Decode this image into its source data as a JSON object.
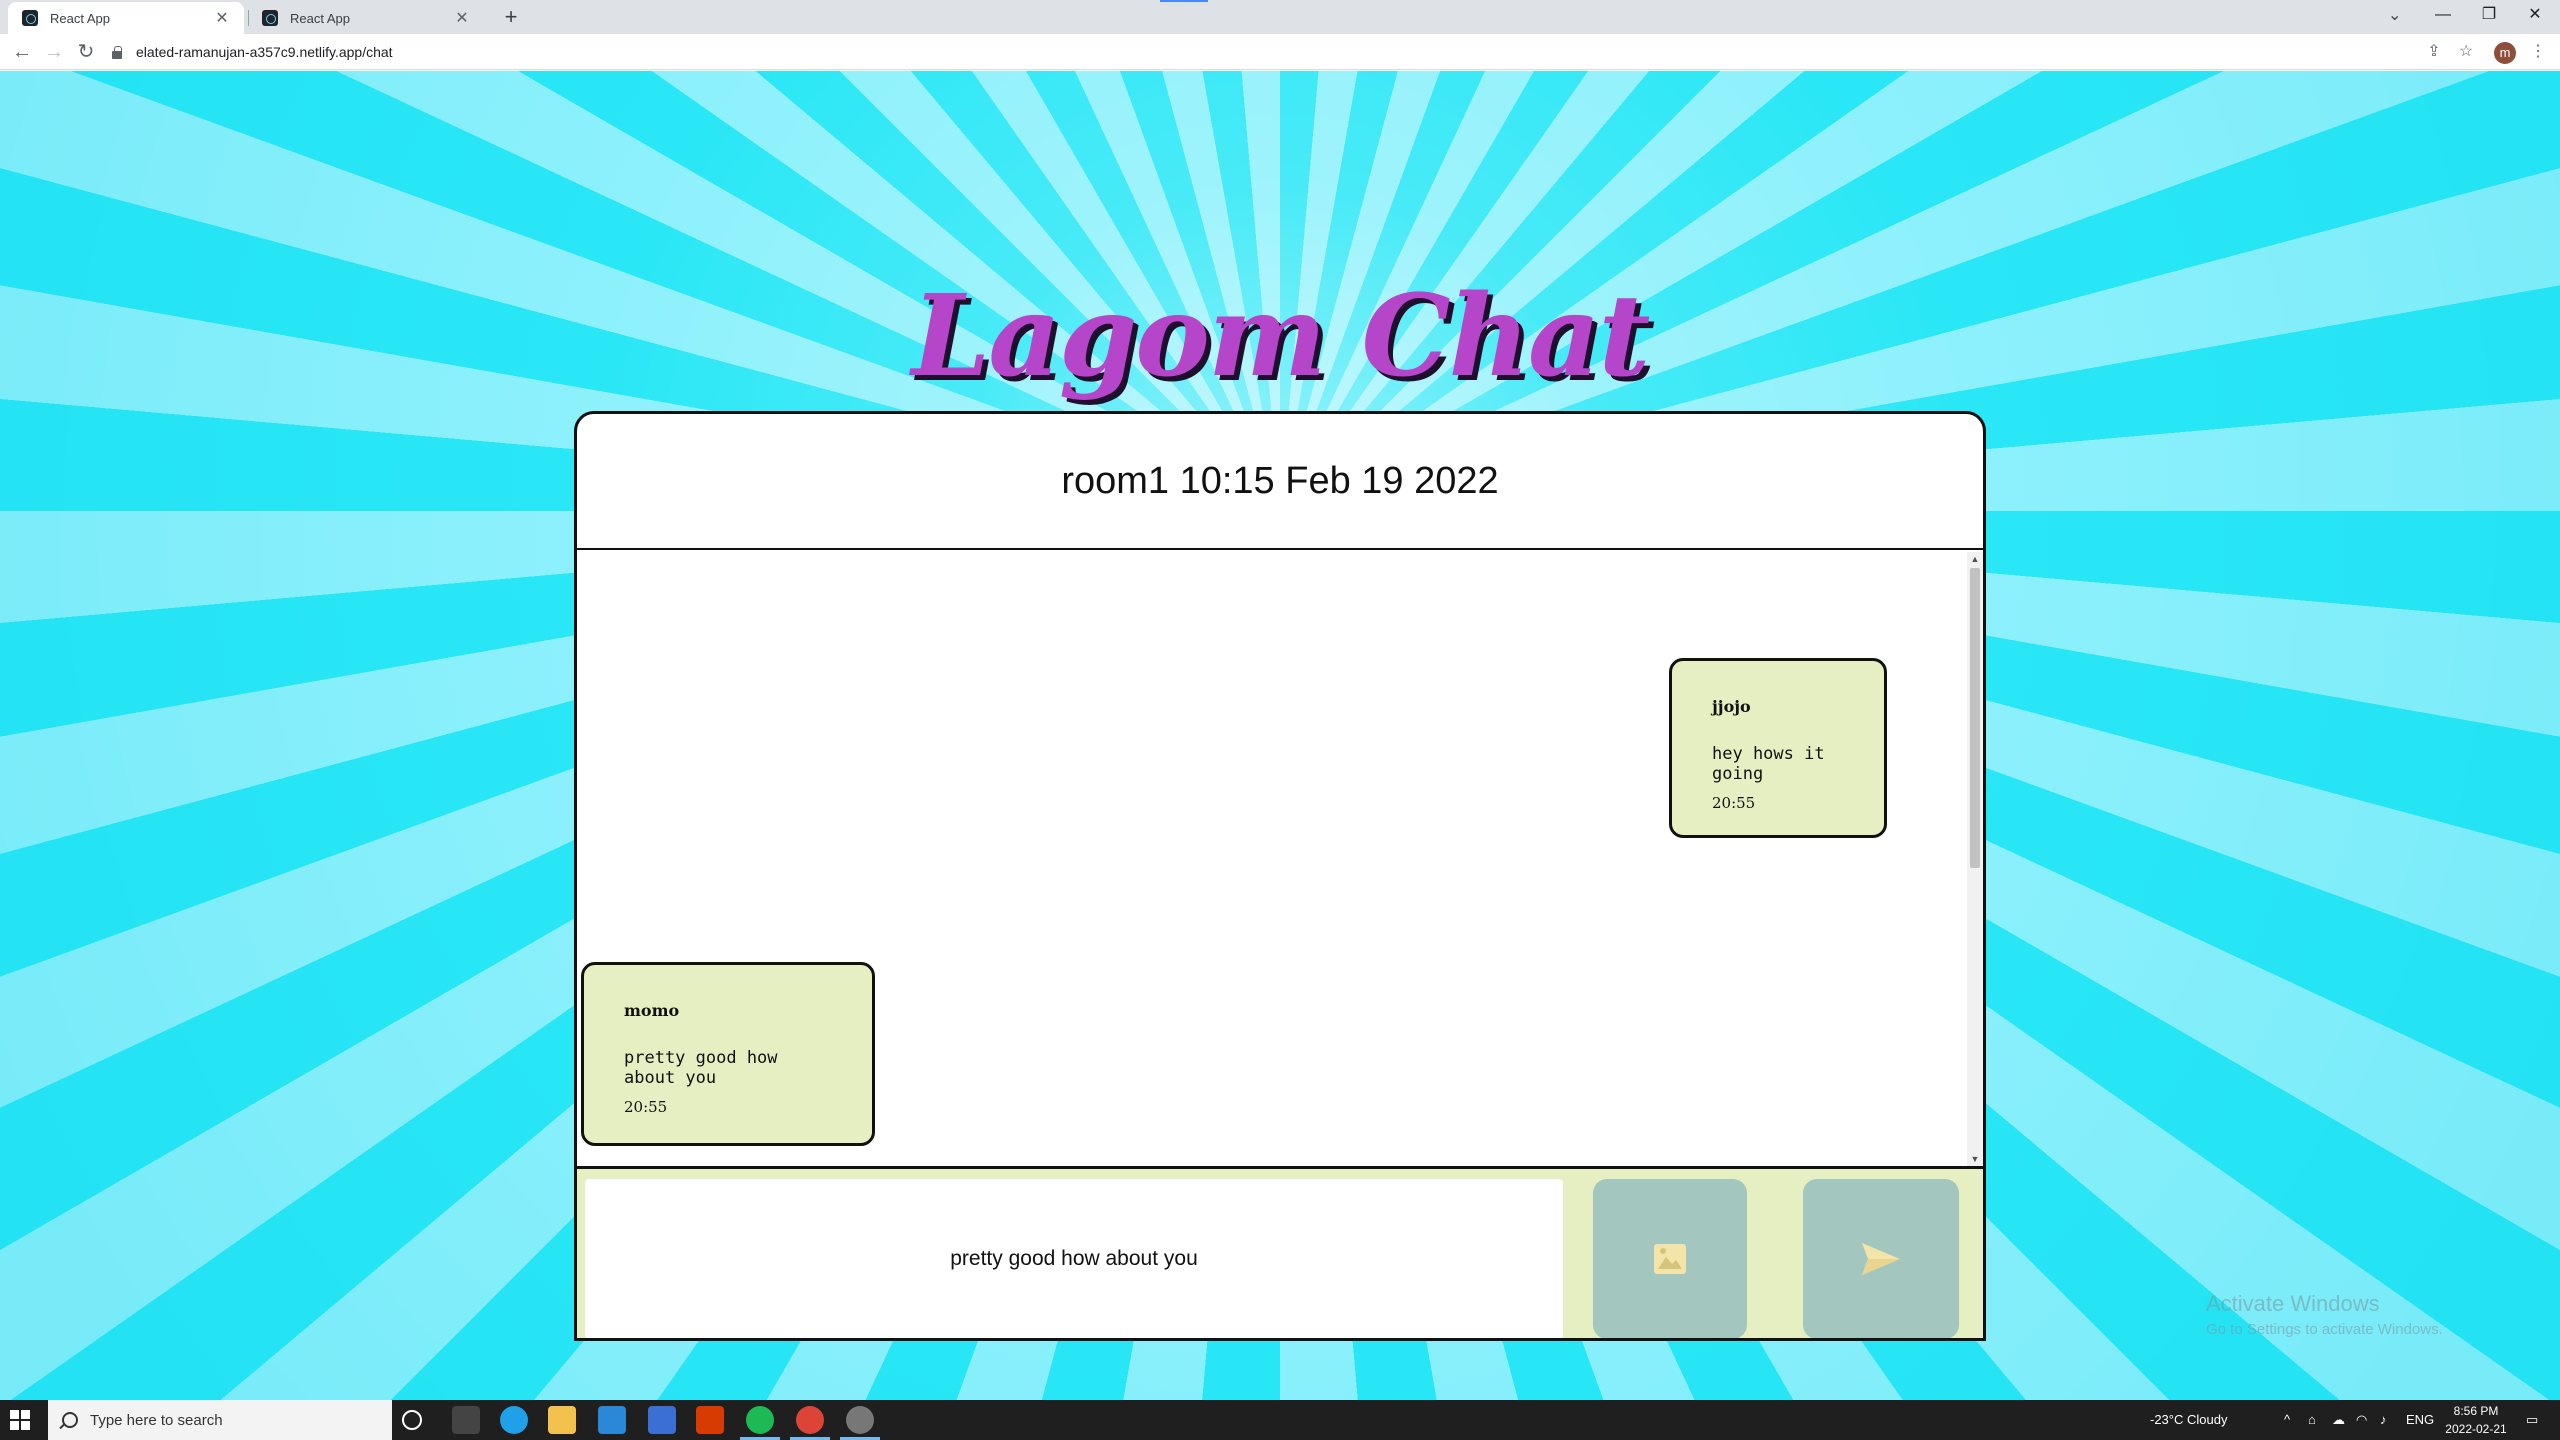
{
  "browser": {
    "tabs": [
      {
        "title": "React App",
        "active": true
      },
      {
        "title": "React App",
        "active": false
      }
    ],
    "url": "elated-ramanujan-a357c9.netlify.app/chat",
    "profile_initial": "m"
  },
  "app": {
    "logo": "Lagom Chat",
    "room_title": "room1 10:15 Feb 19 2022",
    "messages": [
      {
        "author": "jjojo",
        "text": "hey hows it going",
        "time": "20:55",
        "side": "right"
      },
      {
        "author": "momo",
        "text": "pretty good how about you",
        "time": "20:55",
        "side": "left"
      }
    ],
    "composer": {
      "value": "pretty good how about you",
      "image_button_icon": "image-icon",
      "send_button_icon": "send-icon"
    },
    "colors": {
      "logo": "#b545c9",
      "bubble": "#e6efc1",
      "button": "#a3c6bf",
      "background_ray_light": "#8df1fc",
      "background_ray_dark": "#29e7f6"
    }
  },
  "watermark": {
    "line1": "Activate Windows",
    "line2": "Go to Settings to activate Windows."
  },
  "taskbar": {
    "search_placeholder": "Type here to search",
    "weather": "-23°C  Cloudy",
    "language": "ENG",
    "time": "8:56 PM",
    "date": "2022-02-21"
  }
}
